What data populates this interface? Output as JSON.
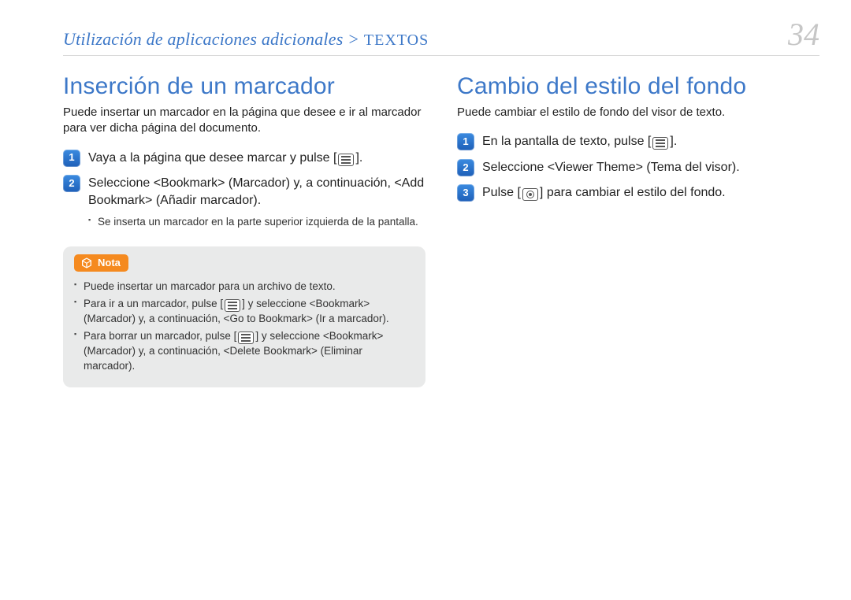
{
  "header": {
    "breadcrumb_main": "Utilización de aplicaciones adicionales >",
    "breadcrumb_sub": " TEXTOS",
    "page_number": "34"
  },
  "left": {
    "title": "Inserción de un marcador",
    "intro": "Puede insertar un marcador en la página que desee e ir al marcador para ver dicha página del documento.",
    "step1_pre": "Vaya a la página que desee marcar y pulse [",
    "step1_post": "].",
    "step2": "Seleccione <Bookmark> (Marcador) y, a continuación, <Add Bookmark> (Añadir marcador).",
    "sub1": "Se inserta un marcador en la parte superior izquierda de la pantalla.",
    "note_label": "Nota",
    "note1": "Puede insertar un marcador para un archivo de texto.",
    "note2_pre": "Para ir a un marcador, pulse [",
    "note2_post": "] y seleccione <Bookmark> (Marcador) y, a continuación, <Go to Bookmark> (Ir a marcador).",
    "note3_pre": "Para borrar un marcador, pulse [",
    "note3_post": "] y seleccione <Bookmark> (Marcador) y, a continuación, <Delete Bookmark> (Eliminar marcador)."
  },
  "right": {
    "title": "Cambio del estilo del fondo",
    "intro": "Puede cambiar el estilo de fondo del visor de texto.",
    "step1_pre": "En la pantalla de texto, pulse [",
    "step1_post": "].",
    "step2": "Seleccione <Viewer Theme> (Tema del visor).",
    "step3_pre": "Pulse [",
    "step3_post": "] para cambiar el estilo del fondo."
  }
}
